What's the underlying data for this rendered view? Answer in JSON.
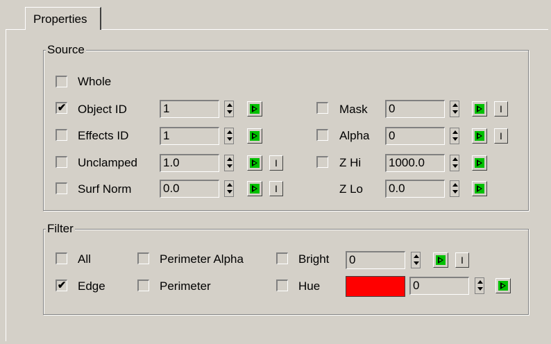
{
  "tab": {
    "label": "Properties"
  },
  "source": {
    "title": "Source",
    "whole": {
      "label": "Whole",
      "checked": false
    },
    "object_id": {
      "label": "Object ID",
      "checked": true,
      "value": "1"
    },
    "effects_id": {
      "label": "Effects ID",
      "checked": false,
      "value": "1"
    },
    "unclamped": {
      "label": "Unclamped",
      "checked": false,
      "value": "1.0",
      "i_label": "I"
    },
    "surf_norm": {
      "label": "Surf Norm",
      "checked": false,
      "value": "0.0",
      "i_label": "I"
    },
    "mask": {
      "label": "Mask",
      "checked": false,
      "value": "0",
      "i_label": "I"
    },
    "alpha": {
      "label": "Alpha",
      "checked": false,
      "value": "0",
      "i_label": "I"
    },
    "z_hi": {
      "label": "Z Hi",
      "checked": false,
      "value": "1000.0"
    },
    "z_lo": {
      "label": "Z Lo",
      "value": "0.0"
    }
  },
  "filter": {
    "title": "Filter",
    "all": {
      "label": "All",
      "checked": false
    },
    "edge": {
      "label": "Edge",
      "checked": true
    },
    "perimeter_alpha": {
      "label": "Perimeter Alpha",
      "checked": false
    },
    "perimeter": {
      "label": "Perimeter",
      "checked": false
    },
    "bright": {
      "label": "Bright",
      "checked": false,
      "value": "0",
      "i_label": "I"
    },
    "hue": {
      "label": "Hue",
      "checked": false,
      "value": "0",
      "color": "#ff0000"
    }
  },
  "check_glyph": "✔",
  "colors": {
    "background": "#d4d0c8",
    "key_green": "#00c000"
  }
}
